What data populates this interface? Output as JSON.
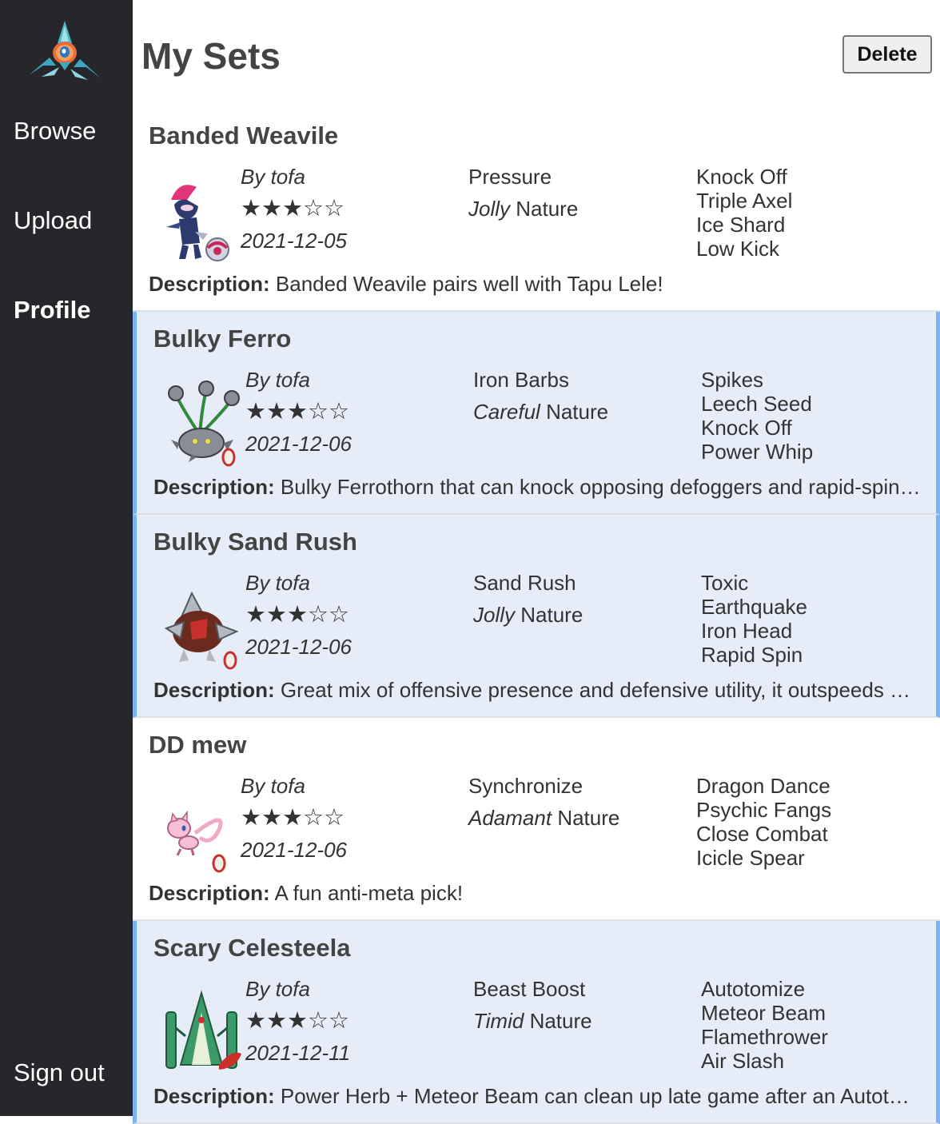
{
  "nav": {
    "items": [
      {
        "label": "Browse"
      },
      {
        "label": "Upload"
      },
      {
        "label": "Profile"
      }
    ],
    "sign_out": "Sign out"
  },
  "header": {
    "title": "My Sets",
    "delete_label": "Delete"
  },
  "description_label": "Description:",
  "nature_suffix": "Nature",
  "colors": {
    "sidebar": "#26272b",
    "selected_row": "#e6edf9",
    "selected_border": "#7bb6f4"
  },
  "sets": [
    {
      "name": "Banded Weavile",
      "author": "By tofa",
      "rating": 3,
      "rating_text": "★★★☆☆",
      "date": "2021-12-05",
      "ability": "Pressure",
      "nature": "Jolly",
      "moves": [
        "Knock Off",
        "Triple Axel",
        "Ice Shard",
        "Low Kick"
      ],
      "description": "Banded Weavile pairs well with Tapu Lele!",
      "selected": false,
      "sprite": "weavile-sprite"
    },
    {
      "name": "Bulky Ferro",
      "author": "By tofa",
      "rating": 3,
      "rating_text": "★★★☆☆",
      "date": "2021-12-06",
      "ability": "Iron Barbs",
      "nature": "Careful",
      "moves": [
        "Spikes",
        "Leech Seed",
        "Knock Off",
        "Power Whip"
      ],
      "description": "Bulky Ferrothorn that can knock opposing defoggers and rapid-spinners",
      "selected": true,
      "sprite": "ferrothorn-sprite"
    },
    {
      "name": "Bulky Sand Rush",
      "author": "By tofa",
      "rating": 3,
      "rating_text": "★★★☆☆",
      "date": "2021-12-06",
      "ability": "Sand Rush",
      "nature": "Jolly",
      "moves": [
        "Toxic",
        "Earthquake",
        "Iron Head",
        "Rapid Spin"
      ],
      "description": "Great mix of offensive presence and defensive utility, it outspeeds most threats",
      "selected": true,
      "sprite": "excadrill-sprite"
    },
    {
      "name": "DD mew",
      "author": "By tofa",
      "rating": 3,
      "rating_text": "★★★☆☆",
      "date": "2021-12-06",
      "ability": "Synchronize",
      "nature": "Adamant",
      "moves": [
        "Dragon Dance",
        "Psychic Fangs",
        "Close Combat",
        "Icicle Spear"
      ],
      "description": "A fun anti-meta pick!",
      "selected": false,
      "sprite": "mew-sprite"
    },
    {
      "name": "Scary Celesteela",
      "author": "By tofa",
      "rating": 3,
      "rating_text": "★★★☆☆",
      "date": "2021-12-11",
      "ability": "Beast Boost",
      "nature": "Timid",
      "moves": [
        "Autotomize",
        "Meteor Beam",
        "Flamethrower",
        "Air Slash"
      ],
      "description": "Power Herb + Meteor Beam can clean up late game after an Autotomize boost",
      "selected": true,
      "sprite": "celesteela-sprite"
    }
  ]
}
